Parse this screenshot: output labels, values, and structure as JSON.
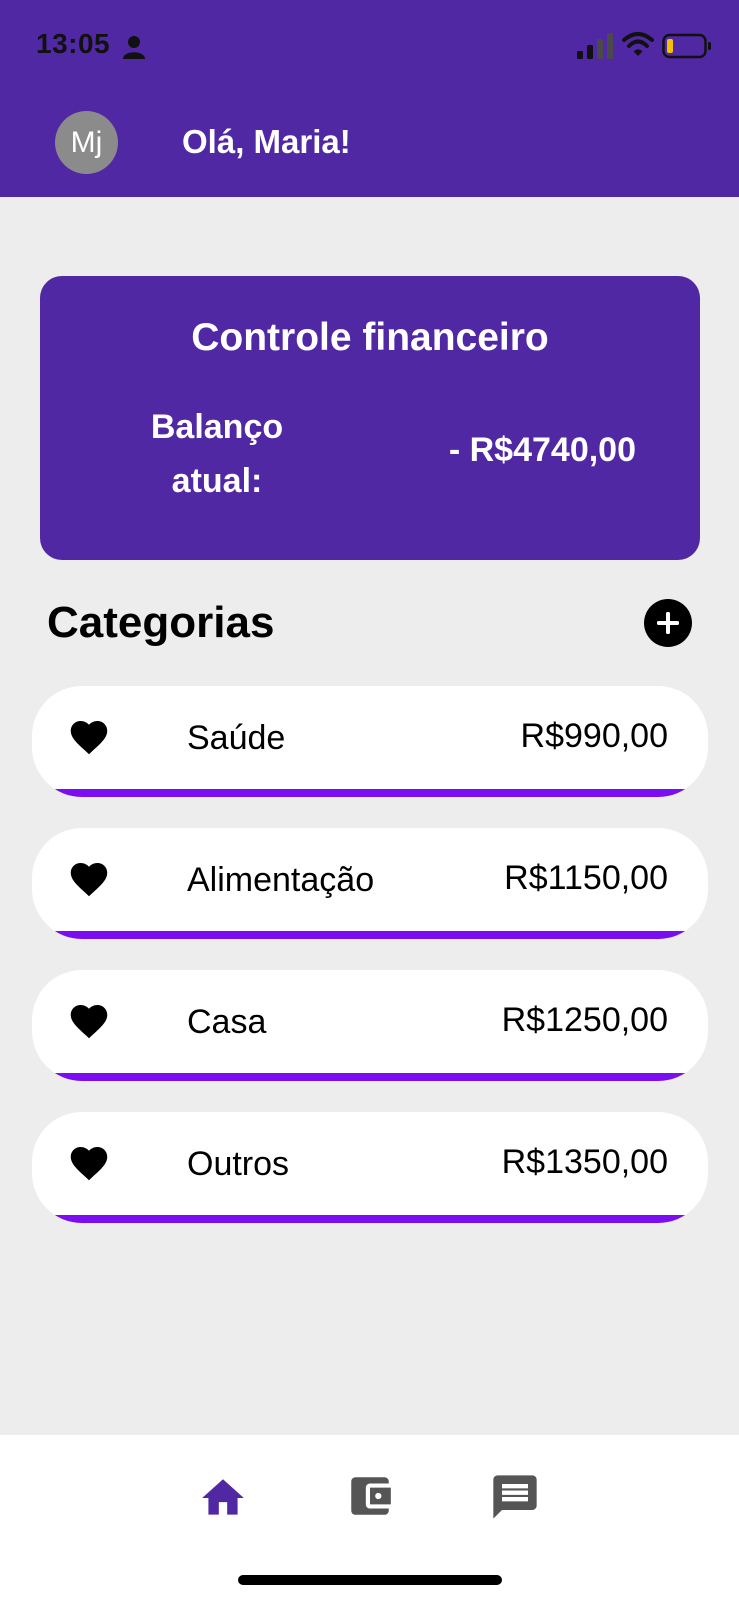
{
  "status_bar": {
    "time": "13:05",
    "icons": [
      "person-icon",
      "signal-icon",
      "wifi-icon",
      "battery-icon"
    ]
  },
  "header": {
    "avatar_initials": "Mj",
    "greeting": "Olá, Maria!"
  },
  "finance_card": {
    "title": "Controle financeiro",
    "balance_label": "Balanço atual:",
    "balance_value": "- R$4740,00"
  },
  "categories": {
    "title": "Categorias",
    "add_icon": "plus-circle-icon",
    "items": [
      {
        "icon": "heart-icon",
        "name": "Saúde",
        "value": "R$990,00"
      },
      {
        "icon": "heart-icon",
        "name": "Alimentação",
        "value": "R$1150,00"
      },
      {
        "icon": "heart-icon",
        "name": "Casa",
        "value": "R$1250,00"
      },
      {
        "icon": "heart-icon",
        "name": "Outros",
        "value": "R$1350,00"
      }
    ]
  },
  "bottom_nav": {
    "items": [
      {
        "icon": "home-icon",
        "active": true
      },
      {
        "icon": "wallet-icon",
        "active": false
      },
      {
        "icon": "chat-icon",
        "active": false
      }
    ]
  },
  "colors": {
    "brand": "#5128a3",
    "accent": "#7a0ef0",
    "background": "#ededed",
    "inactive_icon": "#555555"
  }
}
